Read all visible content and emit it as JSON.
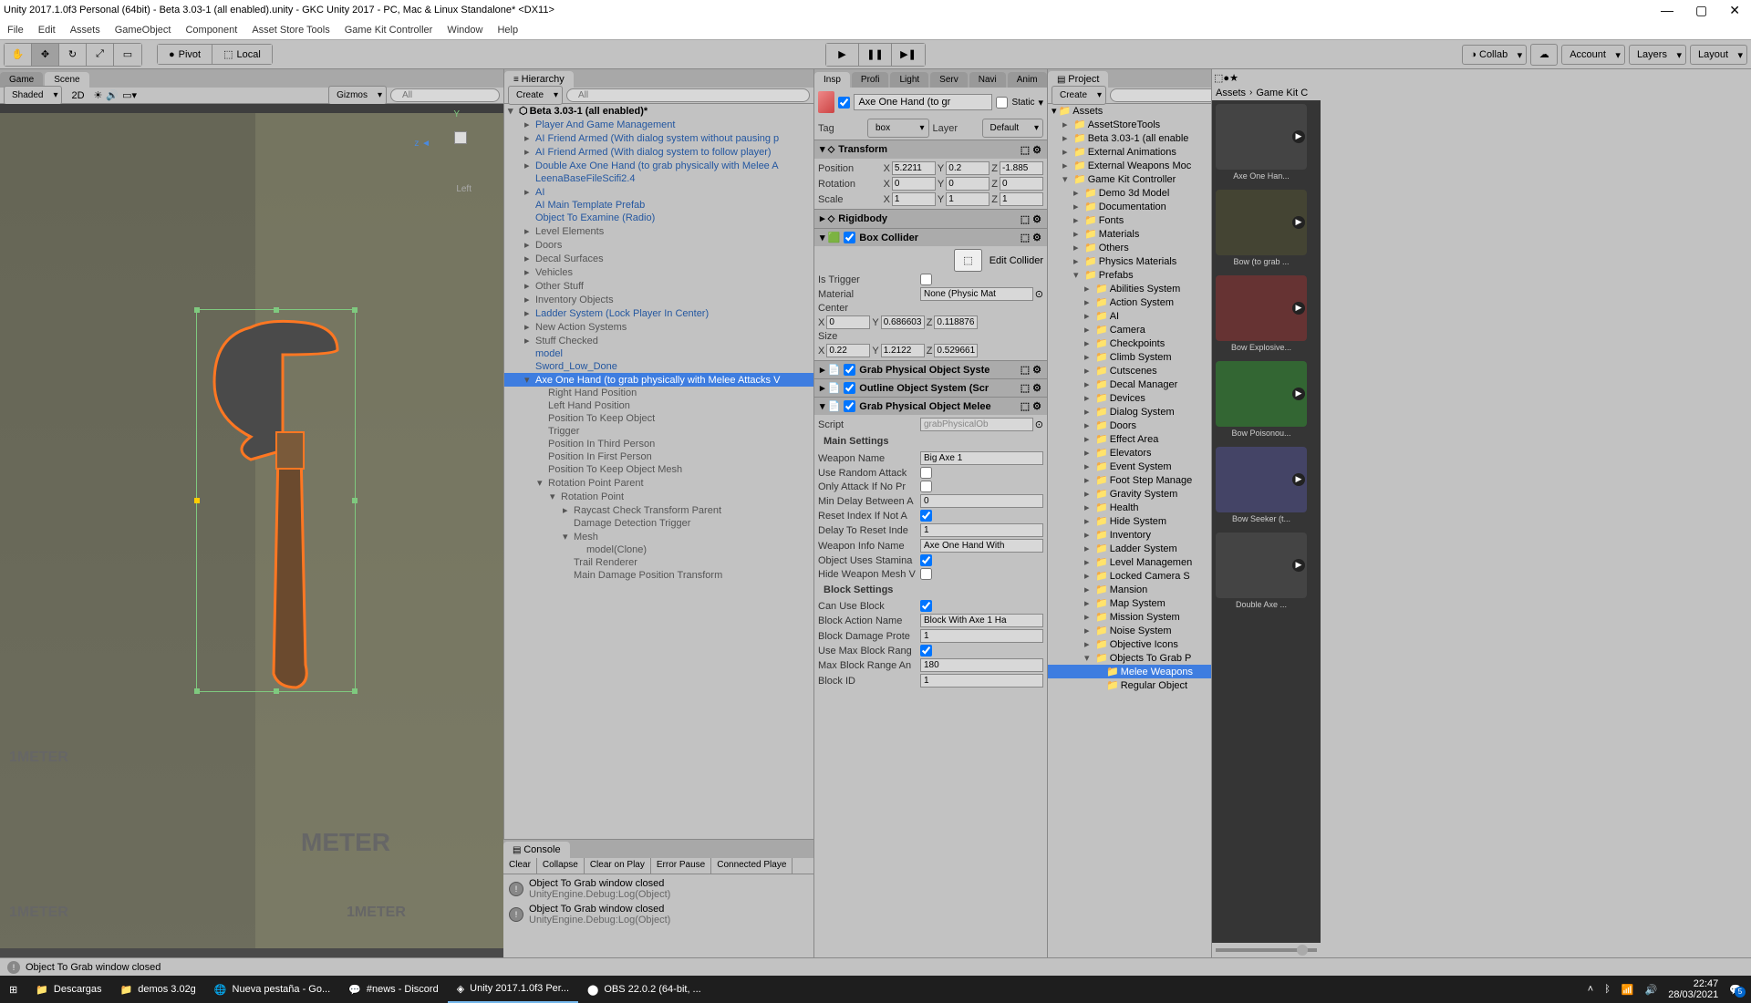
{
  "titlebar": {
    "text": "Unity 2017.1.0f3 Personal (64bit) - Beta 3.03-1 (all enabled).unity - GKC Unity 2017 - PC, Mac & Linux Standalone* <DX11>"
  },
  "menubar": {
    "items": [
      "File",
      "Edit",
      "Assets",
      "GameObject",
      "Component",
      "Asset Store Tools",
      "Game Kit Controller",
      "Window",
      "Help"
    ]
  },
  "toolbar": {
    "pivot": "Pivot",
    "local": "Local",
    "collab": "Collab",
    "account": "Account",
    "layers": "Layers",
    "layout": "Layout"
  },
  "scene": {
    "tab_game": "Game",
    "tab_scene": "Scene",
    "shaded": "Shaded",
    "twod": "2D",
    "gizmos": "Gizmos",
    "search": "All",
    "left_label": "Left",
    "meter": "METER",
    "meter2": "1METER",
    "meter3": "1METER"
  },
  "hierarchy": {
    "title": "Hierarchy",
    "create": "Create",
    "search": "All",
    "root": "Beta 3.03-1 (all enabled)*",
    "items": [
      {
        "text": "Player And Game Management",
        "indent": 1,
        "arrow": "▸"
      },
      {
        "text": "AI Friend Armed (With dialog system without pausing p",
        "indent": 1,
        "arrow": "▸"
      },
      {
        "text": "AI Friend Armed (With dialog system to follow player)",
        "indent": 1,
        "arrow": "▸"
      },
      {
        "text": "Double Axe One Hand (to grab physically with Melee A",
        "indent": 1,
        "arrow": "▸"
      },
      {
        "text": "LeenaBaseFileScifi2.4",
        "indent": 1,
        "arrow": ""
      },
      {
        "text": "AI",
        "indent": 1,
        "arrow": "▸"
      },
      {
        "text": "AI Main Template Prefab",
        "indent": 1,
        "arrow": ""
      },
      {
        "text": "Object To Examine (Radio)",
        "indent": 1,
        "arrow": ""
      },
      {
        "text": "Level Elements",
        "indent": 1,
        "arrow": "▸",
        "dark": true
      },
      {
        "text": "Doors",
        "indent": 1,
        "arrow": "▸",
        "dark": true
      },
      {
        "text": "Decal Surfaces",
        "indent": 1,
        "arrow": "▸",
        "dark": true
      },
      {
        "text": "Vehicles",
        "indent": 1,
        "arrow": "▸",
        "dark": true
      },
      {
        "text": "Other Stuff",
        "indent": 1,
        "arrow": "▸",
        "dark": true
      },
      {
        "text": "Inventory Objects",
        "indent": 1,
        "arrow": "▸",
        "dark": true
      },
      {
        "text": "Ladder System (Lock Player In Center)",
        "indent": 1,
        "arrow": "▸"
      },
      {
        "text": "New Action Systems",
        "indent": 1,
        "arrow": "▸",
        "dark": true
      },
      {
        "text": "Stuff Checked",
        "indent": 1,
        "arrow": "▸",
        "dark": true
      },
      {
        "text": "model",
        "indent": 1,
        "arrow": ""
      },
      {
        "text": "Sword_Low_Done",
        "indent": 1,
        "arrow": ""
      },
      {
        "text": "Axe One Hand (to grab physically with Melee Attacks V",
        "indent": 1,
        "arrow": "▾",
        "selected": true
      }
    ],
    "children": [
      {
        "text": "Right Hand Position",
        "indent": 2
      },
      {
        "text": "Left Hand Position",
        "indent": 2
      },
      {
        "text": "Position To Keep Object",
        "indent": 2
      },
      {
        "text": "Trigger",
        "indent": 2
      },
      {
        "text": "Position In Third Person",
        "indent": 2
      },
      {
        "text": "Position In First Person",
        "indent": 2
      },
      {
        "text": "Position To Keep Object Mesh",
        "indent": 2
      },
      {
        "text": "Rotation Point Parent",
        "indent": 2,
        "arrow": "▾"
      },
      {
        "text": "Rotation Point",
        "indent": 3,
        "arrow": "▾"
      },
      {
        "text": "Raycast Check Transform Parent",
        "indent": 4,
        "arrow": "▸"
      },
      {
        "text": "Damage Detection Trigger",
        "indent": 4
      },
      {
        "text": "Mesh",
        "indent": 4,
        "arrow": "▾"
      },
      {
        "text": "model(Clone)",
        "indent": 5
      },
      {
        "text": "Trail Renderer",
        "indent": 4
      },
      {
        "text": "Main Damage Position Transform",
        "indent": 4
      }
    ]
  },
  "console": {
    "title": "Console",
    "clear": "Clear",
    "collapse": "Collapse",
    "clear_play": "Clear on Play",
    "error_pause": "Error Pause",
    "connected": "Connected Playe",
    "line1a": "Object To Grab window closed",
    "line1b": "UnityEngine.Debug:Log(Object)",
    "line2a": "Object To Grab window closed",
    "line2b": "UnityEngine.Debug:Log(Object)"
  },
  "inspector": {
    "tabs": [
      "Insp",
      "Profi",
      "Light",
      "Serv",
      "Navi",
      "Anim"
    ],
    "object_name": "Axe One Hand (to gr",
    "static": "Static",
    "tag_label": "Tag",
    "tag_value": "box",
    "layer_label": "Layer",
    "layer_value": "Default",
    "transform": {
      "title": "Transform",
      "position": "Position",
      "rotation": "Rotation",
      "scale": "Scale",
      "px": "5.2211",
      "py": "0.2",
      "pz": "-1.885",
      "rx": "0",
      "ry": "0",
      "rz": "0",
      "sx": "1",
      "sy": "1",
      "sz": "1"
    },
    "rigidbody": "Rigidbody",
    "boxcollider": {
      "title": "Box Collider",
      "edit": "Edit Collider",
      "is_trigger": "Is Trigger",
      "material": "Material",
      "material_value": "None (Physic Mat",
      "center": "Center",
      "cx": "0",
      "cy": "0.686603",
      "cz": "0.118876",
      "size": "Size",
      "sx": "0.22",
      "sy": "1.2122",
      "sz": "0.529661"
    },
    "grab_system": "Grab Physical Object Syste",
    "outline_system": "Outline Object System (Scr",
    "grab_melee": "Grab Physical Object Melee",
    "script_label": "Script",
    "script_value": "grabPhysicalOb",
    "main_settings": "Main Settings",
    "weapon_name_label": "Weapon Name",
    "weapon_name": "Big Axe 1",
    "use_random": "Use Random Attack",
    "only_attack": "Only Attack If No Pr",
    "min_delay_label": "Min Delay Between A",
    "min_delay": "0",
    "reset_index": "Reset Index If Not A",
    "delay_reset_label": "Delay To Reset Inde",
    "delay_reset": "1",
    "weapon_info_label": "Weapon Info Name",
    "weapon_info": "Axe One Hand With",
    "uses_stamina": "Object Uses Stamina",
    "hide_mesh": "Hide Weapon Mesh V",
    "block_settings": "Block Settings",
    "can_block": "Can Use Block",
    "block_action_label": "Block Action Name",
    "block_action": "Block With Axe 1 Ha",
    "block_damage_label": "Block Damage Prote",
    "block_damage": "1",
    "use_max_block": "Use Max Block Rang",
    "max_block_label": "Max Block Range An",
    "max_block": "180",
    "block_id_label": "Block ID",
    "block_id": "1"
  },
  "project": {
    "title": "Project",
    "create": "Create",
    "assets": "Assets",
    "items": [
      "AssetStoreTools",
      "Beta 3.03-1 (all enable",
      "External Animations",
      "External Weapons Moc",
      "Game Kit Controller"
    ],
    "gkc_items": [
      "Demo 3d Model",
      "Documentation",
      "Fonts",
      "Materials",
      "Others",
      "Physics Materials",
      "Prefabs"
    ],
    "prefab_items": [
      "Abilities System",
      "Action System",
      "AI",
      "Camera",
      "Checkpoints",
      "Climb System",
      "Cutscenes",
      "Decal Manager",
      "Devices",
      "Dialog System",
      "Doors",
      "Effect Area",
      "Elevators",
      "Event System",
      "Foot Step Manage",
      "Gravity System",
      "Health",
      "Hide System",
      "Inventory",
      "Ladder System",
      "Level Managemen",
      "Locked Camera S",
      "Mansion",
      "Map System",
      "Mission System",
      "Noise System",
      "Objective Icons",
      "Objects To Grab P"
    ],
    "grab_items": [
      "Melee Weapons",
      "Regular Object"
    ]
  },
  "assets": {
    "breadcrumb": [
      "Assets",
      "Game Kit C"
    ],
    "items": [
      "Axe One Han...",
      "Bow (to grab ...",
      "Bow Explosive...",
      "Bow Poisonou...",
      "Bow Seeker (t...",
      "Double Axe ..."
    ]
  },
  "statusbar": {
    "text": "Object To Grab window closed"
  },
  "taskbar": {
    "items": [
      "Descargas",
      "demos 3.02g",
      "Nueva pestaña - Go...",
      "#news - Discord",
      "Unity 2017.1.0f3 Per...",
      "OBS 22.0.2 (64-bit, ..."
    ],
    "time": "22:47",
    "date": "28/03/2021",
    "notif": "5"
  }
}
